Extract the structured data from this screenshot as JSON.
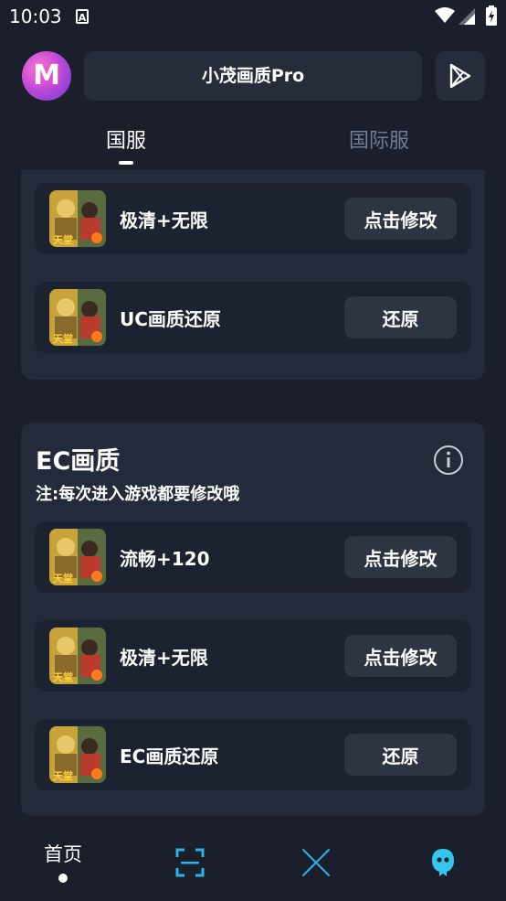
{
  "status_bar": {
    "time": "10:03",
    "notification_glyph": "A"
  },
  "header": {
    "avatar_letter": "M",
    "title": "小茂画质Pro",
    "play_icon": "play-store-icon"
  },
  "tabs": [
    {
      "label": "国服",
      "active": true
    },
    {
      "label": "国际服",
      "active": false
    }
  ],
  "sections": {
    "top": {
      "rows": [
        {
          "label": "极清+无限",
          "button": "点击修改"
        },
        {
          "label": "UC画质还原",
          "button": "还原"
        }
      ]
    },
    "ec": {
      "title": "EC画质",
      "note": "注:每次进入游戏都要修改哦",
      "info_icon": "info-icon",
      "rows": [
        {
          "label": "流畅+120",
          "button": "点击修改"
        },
        {
          "label": "极清+无限",
          "button": "点击修改"
        },
        {
          "label": "EC画质还原",
          "button": "还原"
        }
      ]
    }
  },
  "bottom_nav": {
    "home_label": "首页",
    "icons": [
      "scan-icon",
      "x-icon",
      "face-icon"
    ]
  },
  "colors": {
    "background": "#1a1f2b",
    "card": "#232a39",
    "row": "#1c2230",
    "button": "#2d3442",
    "inactive_tab": "#6f7e94",
    "accent_cyan": "#2ab3e6"
  }
}
